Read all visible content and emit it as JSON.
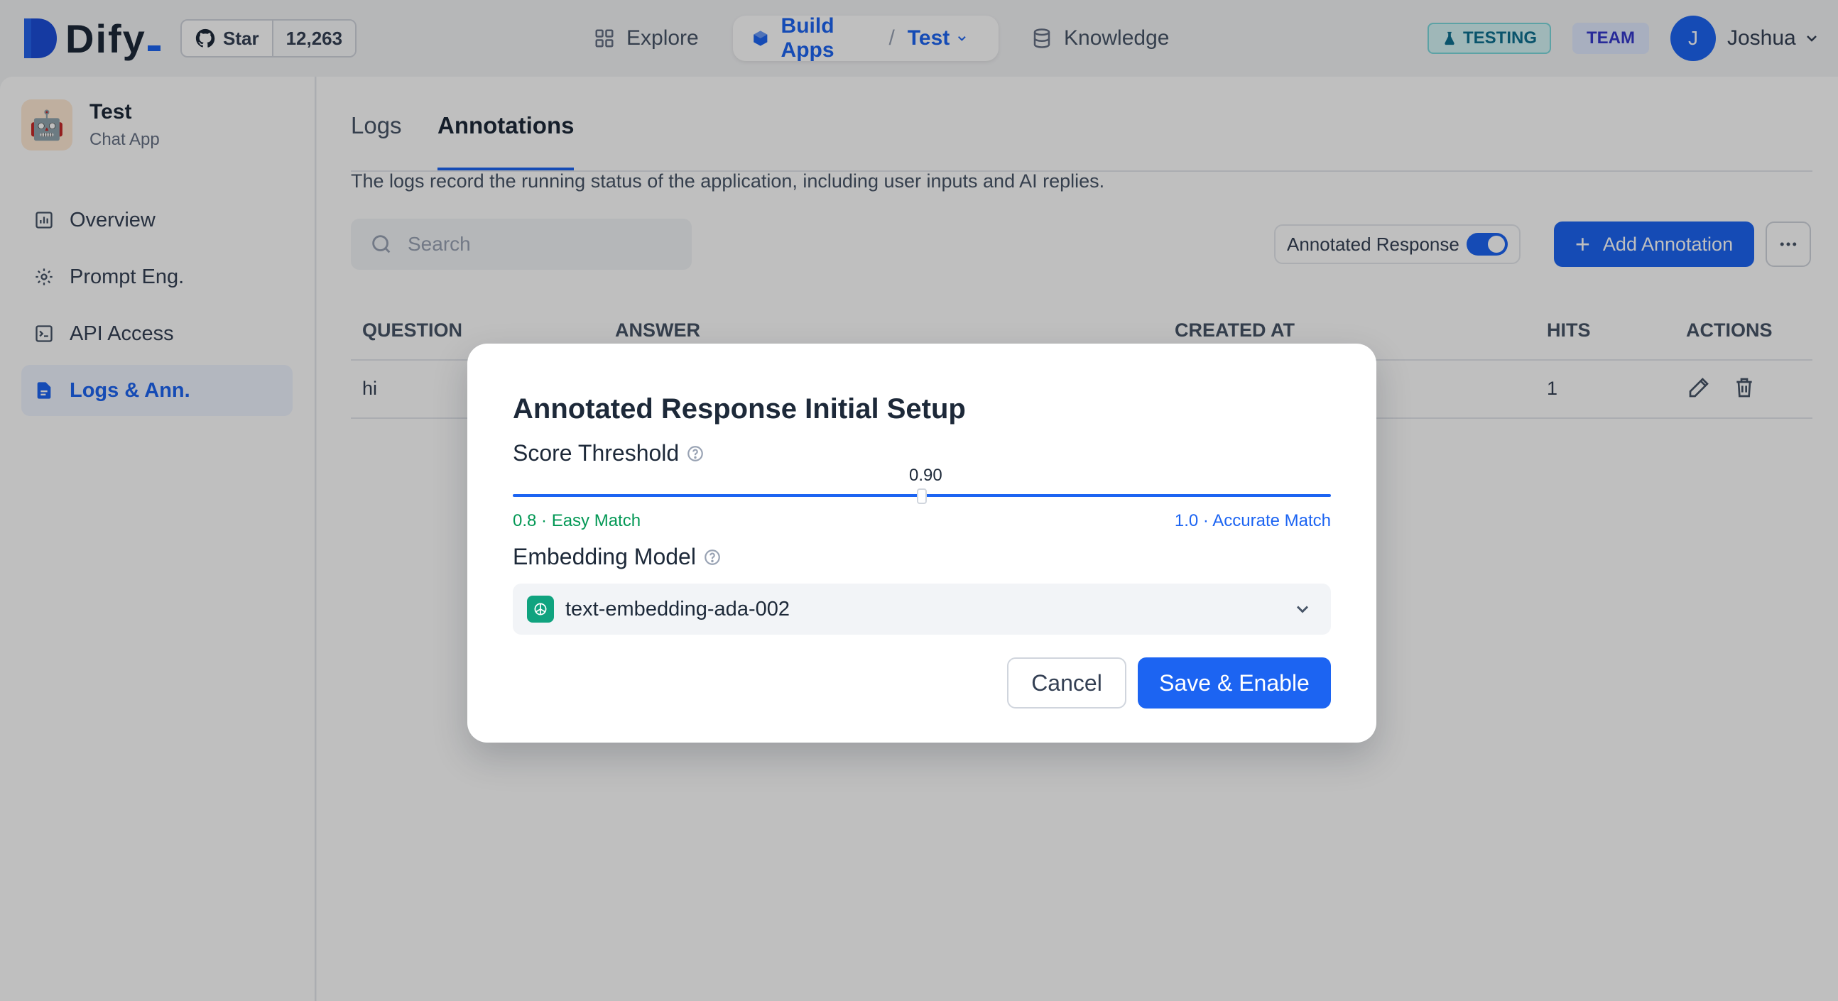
{
  "brand": {
    "name": "Dify"
  },
  "github": {
    "star_label": "Star",
    "count": "12,263"
  },
  "nav": {
    "explore": "Explore",
    "build_apps": "Build Apps",
    "current_app": "Test",
    "knowledge": "Knowledge"
  },
  "header": {
    "testing_badge": "TESTING",
    "team_badge": "TEAM",
    "avatar_letter": "J",
    "user_name": "Joshua"
  },
  "app": {
    "name": "Test",
    "type": "Chat App"
  },
  "sidebar": {
    "items": [
      {
        "label": "Overview",
        "icon": "chart-icon"
      },
      {
        "label": "Prompt Eng.",
        "icon": "gear-icon"
      },
      {
        "label": "API Access",
        "icon": "terminal-icon"
      },
      {
        "label": "Logs & Ann.",
        "icon": "document-icon",
        "active": true
      }
    ]
  },
  "main": {
    "tabs": [
      {
        "label": "Logs"
      },
      {
        "label": "Annotations",
        "active": true
      }
    ],
    "description": "The logs record the running status of the application, including user inputs and AI replies.",
    "search_placeholder": "Search",
    "annotated_response_label": "Annotated Response",
    "annotated_response_enabled": true,
    "add_annotation": "Add Annotation",
    "table": {
      "headers": [
        "QUESTION",
        "ANSWER",
        "CREATED AT",
        "HITS",
        "ACTIONS"
      ],
      "rows": [
        {
          "question": "hi",
          "answer": "",
          "created_at": "",
          "hits": "1"
        }
      ]
    }
  },
  "modal": {
    "title": "Annotated Response Initial Setup",
    "score_threshold_label": "Score Threshold",
    "score_value": "0.90",
    "slider_value": 0.9,
    "slider_min": 0.8,
    "slider_max": 1.0,
    "min_label": "0.8 · Easy Match",
    "max_label": "1.0 · Accurate Match",
    "embedding_model_label": "Embedding Model",
    "embedding_model": "text-embedding-ada-002",
    "cancel": "Cancel",
    "save": "Save & Enable"
  },
  "colors": {
    "primary": "#1c64f2",
    "easy_match": "#039855",
    "openai": "#10a37f"
  }
}
